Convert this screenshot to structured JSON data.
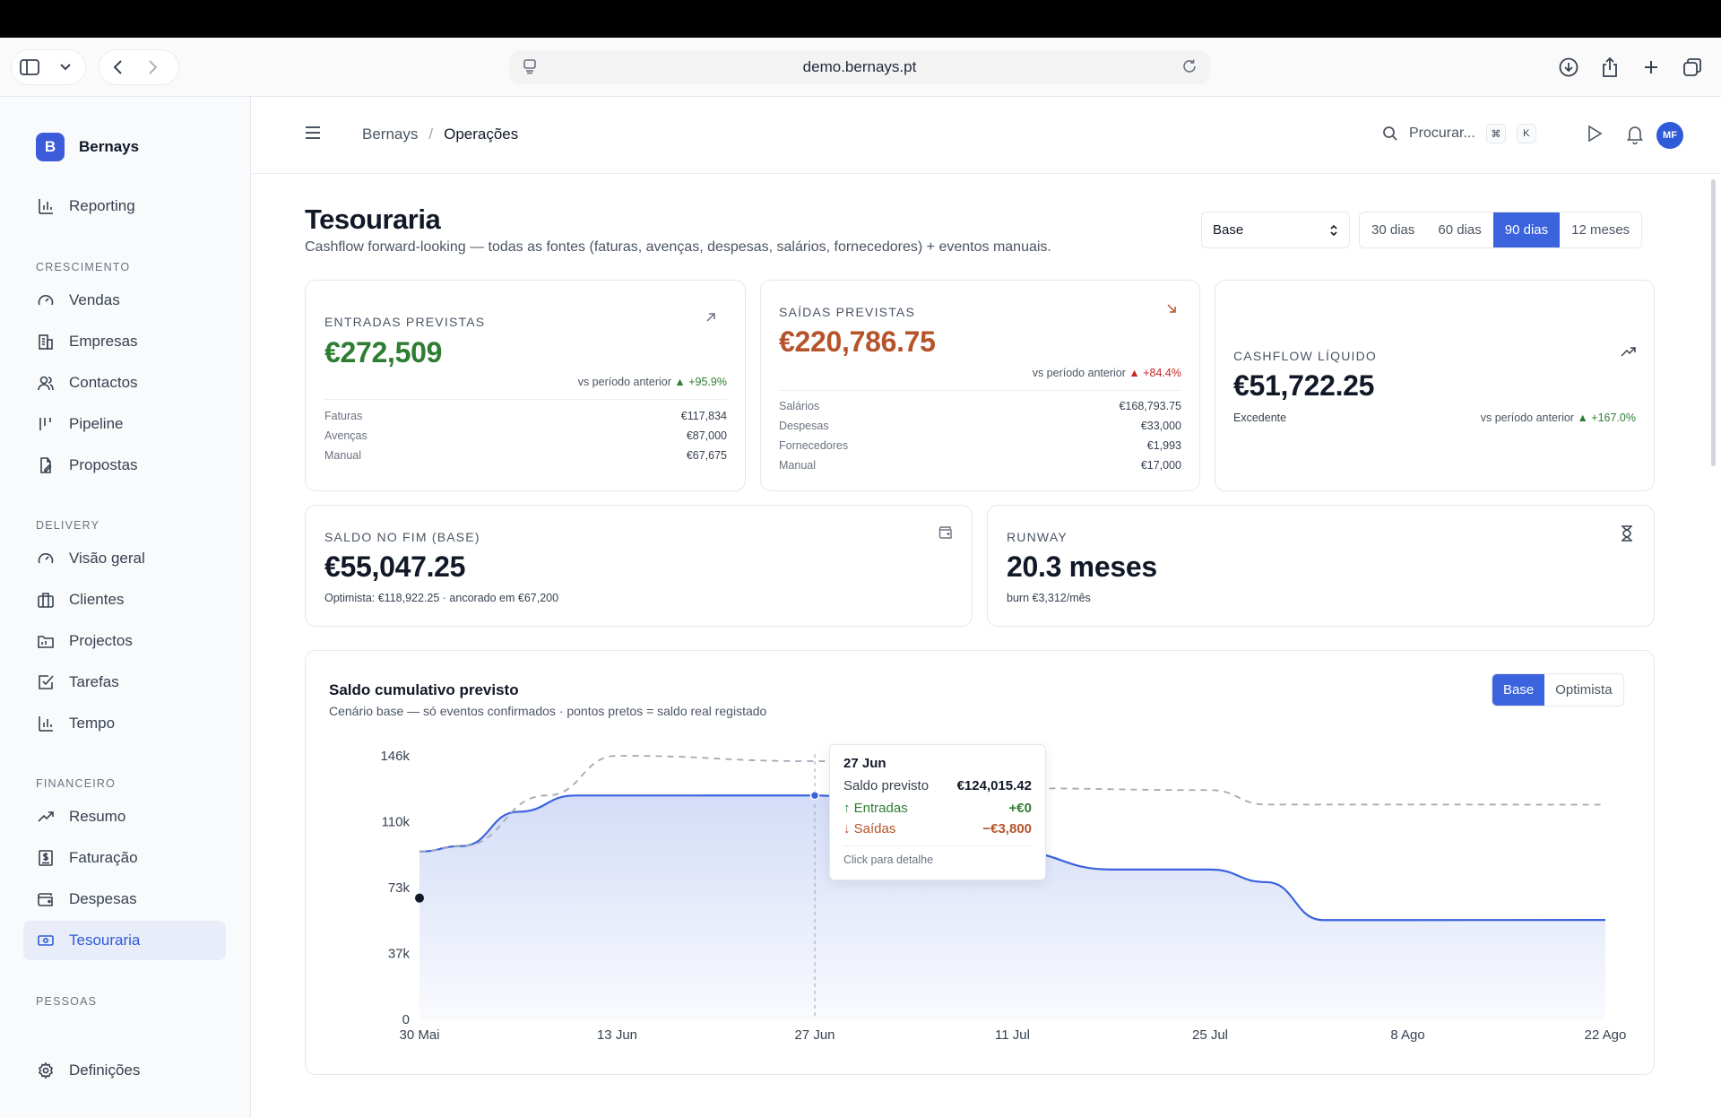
{
  "browser": {
    "url": "demo.bernays.pt"
  },
  "sidebar": {
    "brand_initial": "B",
    "brand_name": "Bernays",
    "top_items": [
      {
        "label": "Reporting",
        "icon": "bar-chart-icon"
      }
    ],
    "sections": [
      {
        "title": "CRESCIMENTO",
        "items": [
          {
            "label": "Vendas",
            "icon": "gauge-icon"
          },
          {
            "label": "Empresas",
            "icon": "building-icon"
          },
          {
            "label": "Contactos",
            "icon": "users-icon"
          },
          {
            "label": "Pipeline",
            "icon": "pipeline-icon"
          },
          {
            "label": "Propostas",
            "icon": "file-edit-icon"
          }
        ]
      },
      {
        "title": "DELIVERY",
        "items": [
          {
            "label": "Visão geral",
            "icon": "gauge-icon"
          },
          {
            "label": "Clientes",
            "icon": "briefcase-icon"
          },
          {
            "label": "Projectos",
            "icon": "folder-icon"
          },
          {
            "label": "Tarefas",
            "icon": "checkbox-icon"
          },
          {
            "label": "Tempo",
            "icon": "bar-chart-icon"
          }
        ]
      },
      {
        "title": "FINANCEIRO",
        "items": [
          {
            "label": "Resumo",
            "icon": "trending-up-icon"
          },
          {
            "label": "Faturação",
            "icon": "receipt-icon"
          },
          {
            "label": "Despesas",
            "icon": "wallet-icon"
          },
          {
            "label": "Tesouraria",
            "icon": "banknote-icon",
            "active": true
          }
        ]
      },
      {
        "title": "PESSOAS",
        "items": []
      }
    ],
    "settings_label": "Definições"
  },
  "header": {
    "breadcrumb": [
      "Bernays",
      "Operações"
    ],
    "search_placeholder": "Procurar...",
    "shortcut_keys": [
      "⌘",
      "K"
    ],
    "avatar_initials": "MF"
  },
  "page": {
    "title": "Tesouraria",
    "subtitle": "Cashflow forward-looking — todas as fontes (faturas, avenças, despesas, salários, fornecedores) + eventos manuais.",
    "scenario_selected": "Base",
    "ranges": [
      "30 dias",
      "60 dias",
      "90 dias",
      "12 meses"
    ],
    "active_range": "90 dias"
  },
  "cards": {
    "inflows": {
      "label": "ENTRADAS PREVISTAS",
      "value": "€272,509",
      "vs_text": "vs período anterior",
      "delta": "▲ +95.9%",
      "breakdown": [
        {
          "name": "Faturas",
          "value": "€117,834"
        },
        {
          "name": "Avenças",
          "value": "€87,000"
        },
        {
          "name": "Manual",
          "value": "€67,675"
        }
      ]
    },
    "outflows": {
      "label": "SAÍDAS PREVISTAS",
      "value": "€220,786.75",
      "vs_text": "vs período anterior",
      "delta": "▲ +84.4%",
      "breakdown": [
        {
          "name": "Salários",
          "value": "€168,793.75"
        },
        {
          "name": "Despesas",
          "value": "€33,000"
        },
        {
          "name": "Fornecedores",
          "value": "€1,993"
        },
        {
          "name": "Manual",
          "value": "€17,000"
        }
      ]
    },
    "net": {
      "label": "CASHFLOW LÍQUIDO",
      "value": "€51,722.25",
      "status": "Excedente",
      "vs_text": "vs período anterior",
      "delta": "▲ +167.0%"
    },
    "balance": {
      "label": "SALDO NO FIM (BASE)",
      "value": "€55,047.25",
      "note": "Optimista: €118,922.25 · ancorado em €67,200"
    },
    "runway": {
      "label": "RUNWAY",
      "value": "20.3 meses",
      "note": "burn €3,312/mês"
    }
  },
  "chart": {
    "title": "Saldo cumulativo previsto",
    "subtitle": "Cenário base — só eventos confirmados · pontos pretos = saldo real registado",
    "toggle": [
      "Base",
      "Optimista"
    ],
    "active_toggle": "Base",
    "tooltip": {
      "date": "27 Jun",
      "balance_label": "Saldo previsto",
      "balance_value": "€124,015.42",
      "in_label": "↑ Entradas",
      "in_value": "+€0",
      "out_label": "↓ Saídas",
      "out_value": "−€3,800",
      "footer": "Click para detalhe"
    }
  },
  "chart_data": {
    "type": "area",
    "title": "Saldo cumulativo previsto",
    "ylim": [
      0,
      146000
    ],
    "y_ticks": [
      "0",
      "37k",
      "73k",
      "110k",
      "146k"
    ],
    "x_ticks": [
      "30 Mai",
      "13 Jun",
      "27 Jun",
      "11 Jul",
      "25 Jul",
      "8 Ago",
      "22 Ago"
    ],
    "series": [
      {
        "name": "Base",
        "style": "solid-fill",
        "color": "#3b63dd",
        "points": [
          {
            "x": "30 Mai",
            "y": 93000
          },
          {
            "x": "2 Jun",
            "y": 96000
          },
          {
            "x": "6 Jun",
            "y": 115000
          },
          {
            "x": "10 Jun",
            "y": 124000
          },
          {
            "x": "13 Jun",
            "y": 124000
          },
          {
            "x": "27 Jun",
            "y": 124015
          },
          {
            "x": "11 Jul",
            "y": 93000
          },
          {
            "x": "18 Jul",
            "y": 83000
          },
          {
            "x": "25 Jul",
            "y": 83000
          },
          {
            "x": "29 Jul",
            "y": 76000
          },
          {
            "x": "2 Ago",
            "y": 55000
          },
          {
            "x": "8 Ago",
            "y": 55000
          },
          {
            "x": "22 Ago",
            "y": 55047
          }
        ]
      },
      {
        "name": "Optimista",
        "style": "dashed",
        "color": "#a3a8b3",
        "points": [
          {
            "x": "30 Mai",
            "y": 93000
          },
          {
            "x": "2 Jun",
            "y": 96000
          },
          {
            "x": "8 Jun",
            "y": 124000
          },
          {
            "x": "13 Jun",
            "y": 146000
          },
          {
            "x": "27 Jun",
            "y": 143000
          },
          {
            "x": "11 Jul",
            "y": 128000
          },
          {
            "x": "25 Jul",
            "y": 127000
          },
          {
            "x": "29 Jul",
            "y": 119000
          },
          {
            "x": "8 Ago",
            "y": 119000
          },
          {
            "x": "22 Ago",
            "y": 118922
          }
        ]
      }
    ],
    "actual_points": [
      {
        "x": "30 Mai",
        "y": 67200
      }
    ],
    "hover": {
      "x": "27 Jun",
      "y": 124015
    }
  }
}
